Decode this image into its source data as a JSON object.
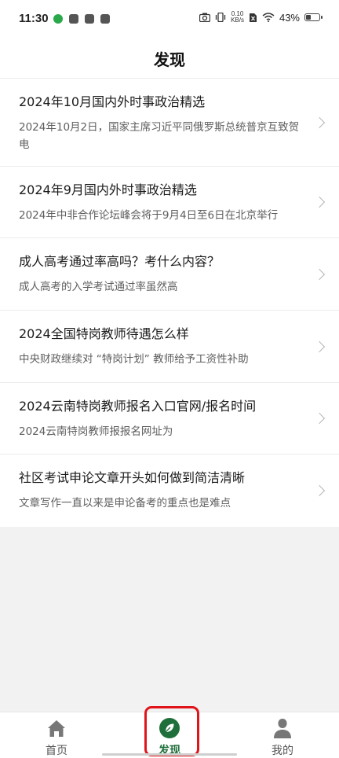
{
  "status": {
    "time": "11:30",
    "net_speed_value": "0.10",
    "net_speed_unit": "KB/s",
    "battery_text": "43%",
    "battery_level": 0.43
  },
  "header": {
    "title": "发现"
  },
  "articles": [
    {
      "title": "2024年10月国内外时事政治精选",
      "desc": "2024年10月2日，国家主席习近平同俄罗斯总统普京互致贺电"
    },
    {
      "title": "2024年9月国内外时事政治精选",
      "desc": "2024年中非合作论坛峰会将于9月4日至6日在北京举行"
    },
    {
      "title": "成人高考通过率高吗？考什么内容？",
      "desc": "成人高考的入学考试通过率虽然高"
    },
    {
      "title": "2024全国特岗教师待遇怎么样",
      "desc": "中央财政继续对 “特岗计划” 教师给予工资性补助"
    },
    {
      "title": "2024云南特岗教师报名入口官网/报名时间",
      "desc": "2024云南特岗教师报报名网址为"
    },
    {
      "title": "社区考试申论文章开头如何做到简洁清晰",
      "desc": "文章写作一直以来是申论备考的重点也是难点"
    }
  ],
  "tabbar": {
    "tabs": [
      {
        "label": "首页",
        "icon": "home-icon"
      },
      {
        "label": "发现",
        "icon": "leaf-icon"
      },
      {
        "label": "我的",
        "icon": "user-icon"
      }
    ],
    "active_index": 1,
    "accent_color": "#1f6f3a",
    "highlight_color": "#e0141a"
  }
}
